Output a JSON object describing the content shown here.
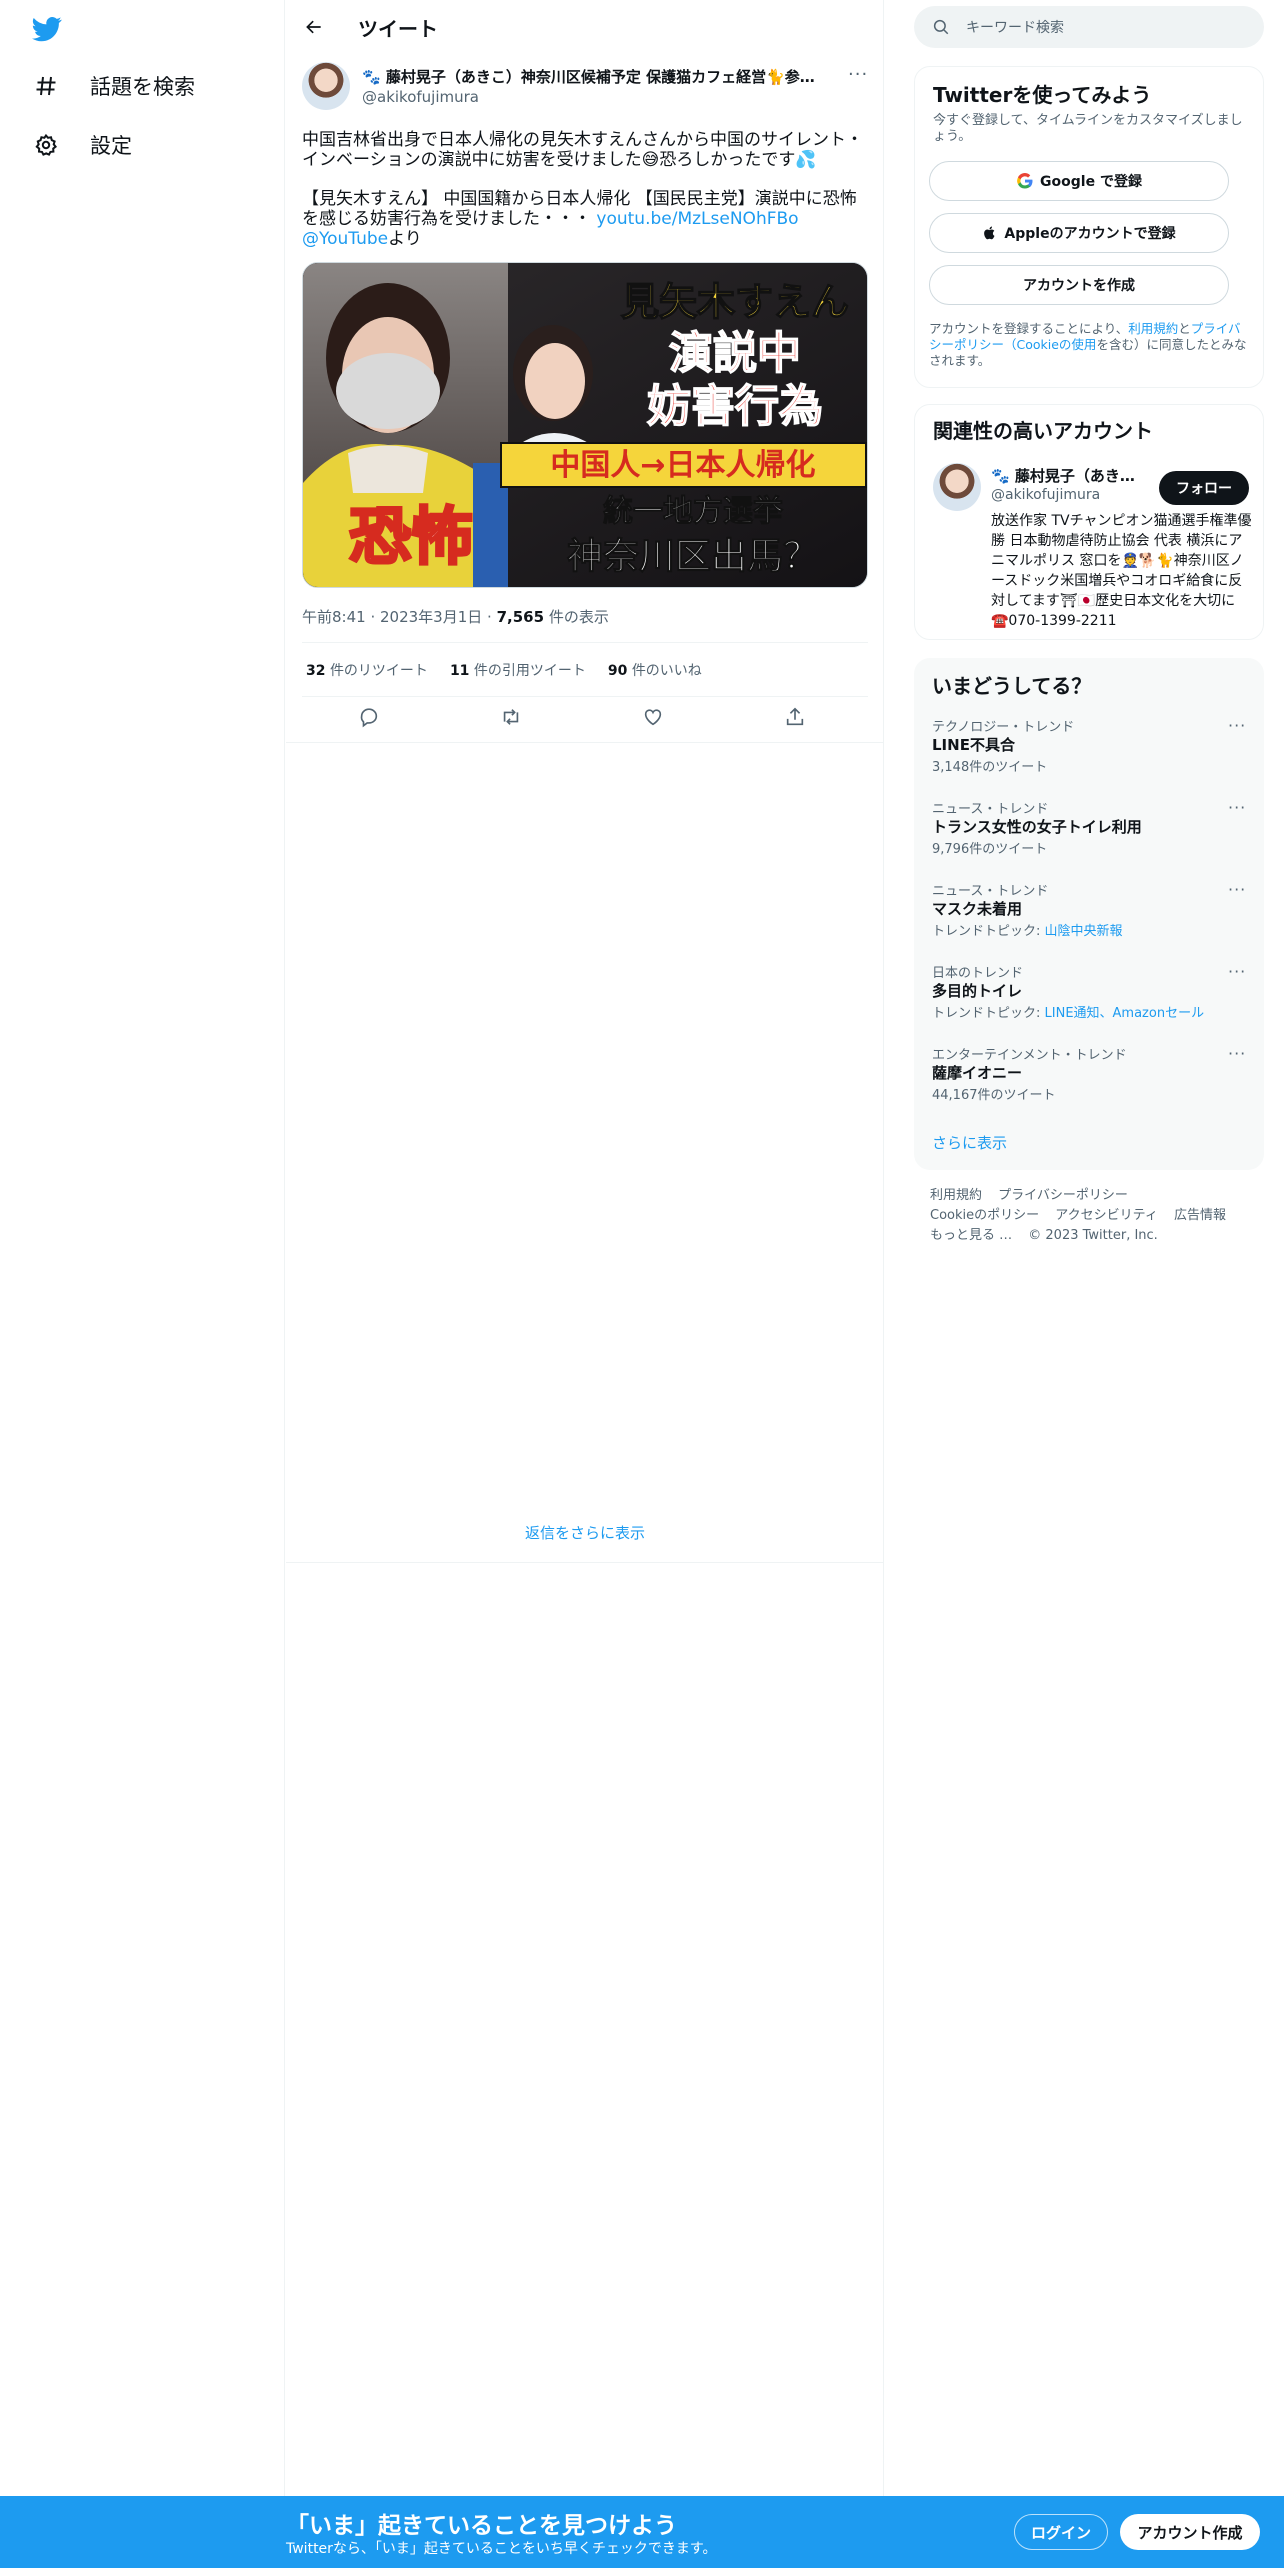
{
  "nav": {
    "explore_label": "話題を検索",
    "settings_label": "設定"
  },
  "header": {
    "title": "ツイート"
  },
  "tweet": {
    "author_name": "🐾 藤村晃子（あきこ）神奈川区候補予定 保護猫カフェ経営🐈参…",
    "author_handle": "@akikofujimura",
    "line1a": "中国吉林省出身で日本人帰化の見矢木すえんさんから中国のサイレント・",
    "line1b": "インベーションの演説中に妨害を受けました😅恐ろしかったです💦",
    "line2a": "【見矢木すえん】 中国国籍から日本人帰化 【国民民主党】演説中に恐怖",
    "line2b": "を感じる妨害行為を受けました・・・ ",
    "line2_link": "youtu.be/MzLseNOhFBo",
    "line3_link": "@YouTube",
    "line3_suffix": "より",
    "media_texts": {
      "t1": "見矢木すえん",
      "t2": "演説中",
      "t3": "妨害行為",
      "t4": "中国人→日本人帰化",
      "t5": "統一地方選挙",
      "t6": "神奈川区出馬？",
      "t7": "恐怖"
    },
    "time": "午前8:41",
    "date": "2023年3月1日",
    "views_count": "7,565",
    "views_label": "件の表示",
    "retweets_count": "32",
    "retweets_label": "件のリツイート",
    "quotes_count": "11",
    "quotes_label": "件の引用ツイート",
    "likes_count": "90",
    "likes_label": "件のいいね",
    "more_replies": "返信をさらに表示"
  },
  "search": {
    "placeholder": "キーワード検索"
  },
  "signup_card": {
    "title": "Twitterを使ってみよう",
    "subtitle": "今すぐ登録して、タイムラインをカスタマイズしましょう。",
    "google_button": "Google で登録",
    "apple_button": "Appleのアカウントで登録",
    "create_button": "アカウントを作成",
    "terms_prefix": "アカウントを登録することにより、",
    "terms_link1": "利用規約",
    "terms_and": "と",
    "terms_link2": "プライバシーポリシー（Cookieの使用",
    "terms_suffix": "を含む）に同意したとみなされます。"
  },
  "related": {
    "title": "関連性の高いアカウント",
    "name": "🐾 藤村晃子（あき…",
    "handle": "@akikofujimura",
    "follow_button": "フォロー",
    "bio": "放送作家 TVチャンピオン猫通選手権準優勝 日本動物虐待防止協会 代表 横浜にアニマルポリス 窓口を👮🐕🐈神奈川区ノースドック米国増兵やコオロギ給食に反対してます⛩🇯🇵歴史日本文化を大切に☎️070-1399-2211"
  },
  "trends": {
    "title": "いまどうしてる？",
    "items": [
      {
        "context": "テクノロジー・トレンド",
        "name": "LINE不具合",
        "count": "3,148件のツイート"
      },
      {
        "context": "ニュース・トレンド",
        "name": "トランス女性の女子トイレ利用",
        "count": "9,796件のツイート"
      },
      {
        "context": "ニュース・トレンド",
        "name": "マスク未着用",
        "count_prefix": "トレンドトピック: ",
        "count_link": "山陰中央新報"
      },
      {
        "context": "日本のトレンド",
        "name": "多目的トイレ",
        "count_prefix": "トレンドトピック: ",
        "count_link": "LINE通知、Amazonセール"
      },
      {
        "context": "エンターテインメント・トレンド",
        "name": "薩摩イオニー",
        "count": "44,167件のツイート"
      }
    ],
    "show_more": "さらに表示"
  },
  "footer": {
    "terms": "利用規約",
    "privacy": "プライバシーポリシー",
    "cookie": "Cookieのポリシー",
    "accessibility": "アクセシビリティ",
    "ads": "広告情報",
    "more": "もっと見る …",
    "copyright": "© 2023 Twitter, Inc."
  },
  "bottom_bar": {
    "title": "「いま」起きていることを見つけよう",
    "subtitle": "Twitterなら、「いま」起きていることをいち早くチェックできます。",
    "login": "ログイン",
    "signup": "アカウント作成"
  },
  "colors": {
    "brand": "#1d9bf0",
    "text": "#0f1419",
    "muted": "#536471",
    "border": "#eff3f4"
  },
  "icons": [
    "twitter-logo-icon",
    "hashtag-icon",
    "gear-icon",
    "back-arrow-icon",
    "more-icon",
    "reply-icon",
    "retweet-icon",
    "like-icon",
    "share-icon",
    "search-icon",
    "google-icon",
    "apple-icon"
  ]
}
